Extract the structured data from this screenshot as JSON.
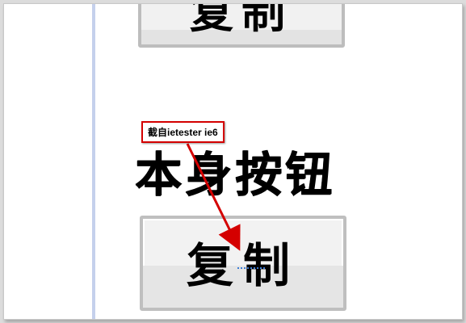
{
  "top_button": {
    "label": "复制"
  },
  "heading": {
    "text": "本身按钮"
  },
  "main_button": {
    "label": "复制"
  },
  "annotation": {
    "text": "截自ietester ie6",
    "color": "#d40000"
  }
}
